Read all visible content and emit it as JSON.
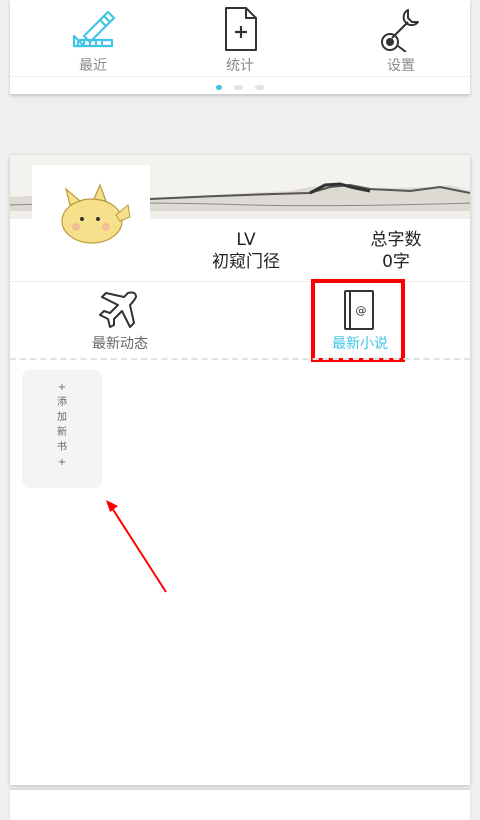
{
  "top_nav": {
    "items": [
      {
        "label": "最近",
        "icon": "pencil-ruler-icon"
      },
      {
        "label": "统计",
        "icon": "document-plus-icon"
      },
      {
        "label": "设置",
        "icon": "tools-icon"
      }
    ],
    "page_index": 1,
    "page_count": 3
  },
  "profile": {
    "level_label": "LV",
    "level_name": "初窥门径",
    "word_count_label": "总字数",
    "word_count_value": "0字"
  },
  "tabs": [
    {
      "label": "最新动态",
      "icon": "airplane-icon",
      "active": false
    },
    {
      "label": "最新小说",
      "icon": "book-at-icon",
      "active": true
    }
  ],
  "add_book_label": "+ 添 加 新 书 +",
  "colors": {
    "accent": "#3fc6e6",
    "highlight": "#ff0000"
  }
}
